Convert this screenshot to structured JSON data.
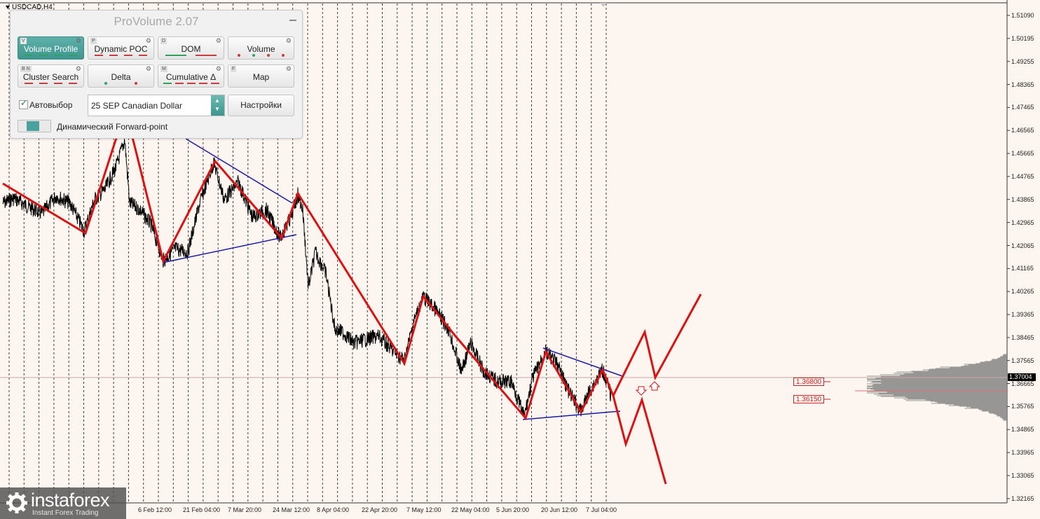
{
  "chart": {
    "symbol": "USDCAD,H4",
    "current_price": "1.37004",
    "price_ticks": [
      "1.51090",
      "1.50195",
      "1.49255",
      "1.48365",
      "1.47465",
      "1.46565",
      "1.45665",
      "1.44765",
      "1.43865",
      "1.42965",
      "1.42065",
      "1.41165",
      "1.40265",
      "1.39365",
      "1.38465",
      "1.37565",
      "1.36665",
      "1.35765",
      "1.34865",
      "1.33965",
      "1.33065",
      "1.32165"
    ],
    "date_ticks": [
      "6 Feb 12:00",
      "21 Feb 04:00",
      "7 Mar 20:00",
      "24 Mar 12:00",
      "8 Apr 04:00",
      "22 Apr 20:00",
      "7 May 12:00",
      "22 May 04:00",
      "5 Jun 20:00",
      "20 Jun 12:00",
      "7 Jul 04:00"
    ],
    "levels": [
      {
        "label": "1.36800",
        "color": "#cc2222"
      },
      {
        "label": "1.36150",
        "color": "#cc2222"
      }
    ],
    "colors": {
      "zigzag": "#dd1111",
      "trendline": "#1a1aaa",
      "price": "#000000",
      "profile": "#8c8c8c",
      "background": "#fdf5ef"
    }
  },
  "panel": {
    "title": "ProVolume 2.07",
    "buttons": [
      {
        "key": "V",
        "label": "Volume Profile",
        "active": true
      },
      {
        "key": "P",
        "label": "Dynamic POC",
        "active": false
      },
      {
        "key": "D",
        "label": "DOM",
        "active": false
      },
      {
        "key": "",
        "label": "Volume",
        "active": false
      },
      {
        "key": "B N",
        "label": "Cluster Search",
        "active": false
      },
      {
        "key": "",
        "label": "Delta",
        "active": false
      },
      {
        "key": "M",
        "label": "Cumulative Δ",
        "active": false
      },
      {
        "key": "F",
        "label": "Map",
        "active": false
      }
    ],
    "auto_label": "Автовыбор",
    "auto_checked": true,
    "instrument": "25 SEP Canadian Dollar",
    "settings_label": "Настройки",
    "forward_label": "Динамический Forward-point"
  },
  "logo": {
    "name": "instaforex",
    "tagline": "Instant Forex Trading"
  }
}
